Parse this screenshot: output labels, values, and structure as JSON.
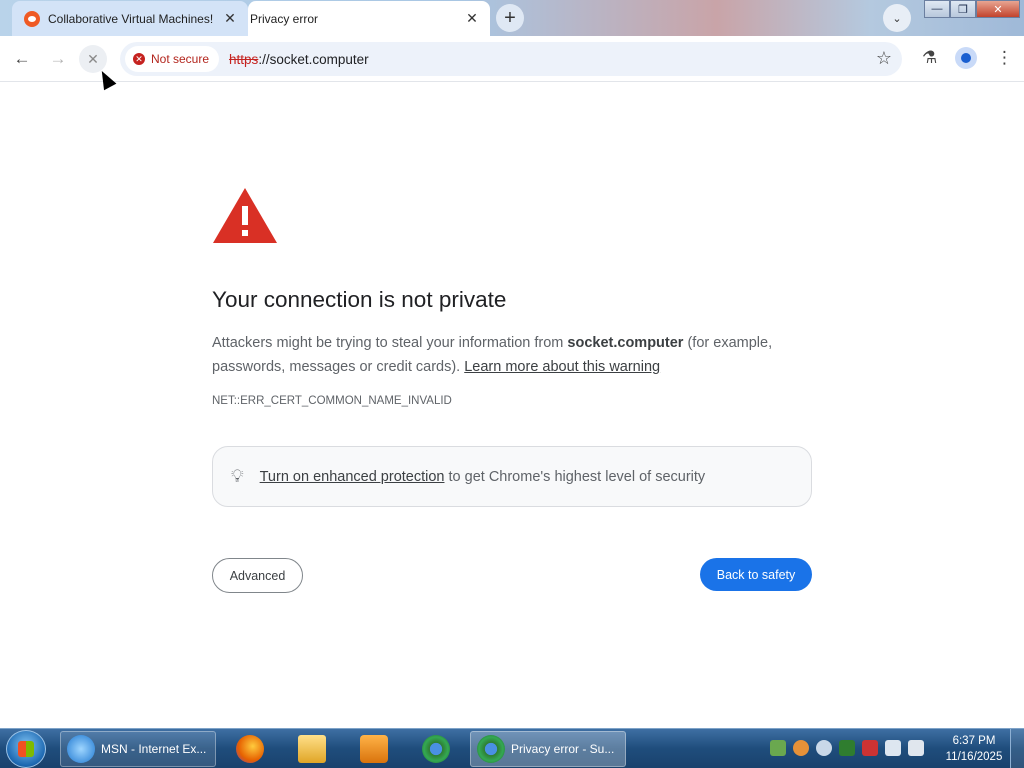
{
  "browser": {
    "tabs": [
      {
        "title": "Collaborative Virtual Machines!",
        "active": false,
        "favicon": "reddit-icon"
      },
      {
        "title": "Privacy error",
        "active": true,
        "favicon": "none"
      }
    ],
    "new_tab": "+",
    "security_chip": "Not secure",
    "url_scheme": "https",
    "url_rest": "://socket.computer"
  },
  "page": {
    "heading": "Your connection is not private",
    "desc_part1": "Attackers might be trying to steal your information from ",
    "domain": "socket.computer",
    "desc_part2": " (for example, passwords, messages or credit cards). ",
    "learn_more": "Learn more about this warning",
    "error_code": "NET::ERR_CERT_COMMON_NAME_INVALID",
    "enhanced_link": "Turn on enhanced protection",
    "enhanced_rest": " to get Chrome's highest level of security",
    "advanced_button": "Advanced",
    "back_button": "Back to safety"
  },
  "taskbar": {
    "items": [
      {
        "label": "MSN - Internet Ex...",
        "icon": "ie-icon"
      },
      {
        "label": "",
        "icon": "firefox-icon"
      },
      {
        "label": "",
        "icon": "explorer-icon"
      },
      {
        "label": "",
        "icon": "media-player-icon"
      },
      {
        "label": "",
        "icon": "chrome-icon"
      },
      {
        "label": "Privacy error - Su...",
        "icon": "chrome-icon"
      }
    ],
    "time": "6:37 PM",
    "date": "11/16/2025"
  },
  "colors": {
    "primary_button": "#1a73e8",
    "warning_red": "#d93025",
    "not_secure": "#c5221f"
  }
}
